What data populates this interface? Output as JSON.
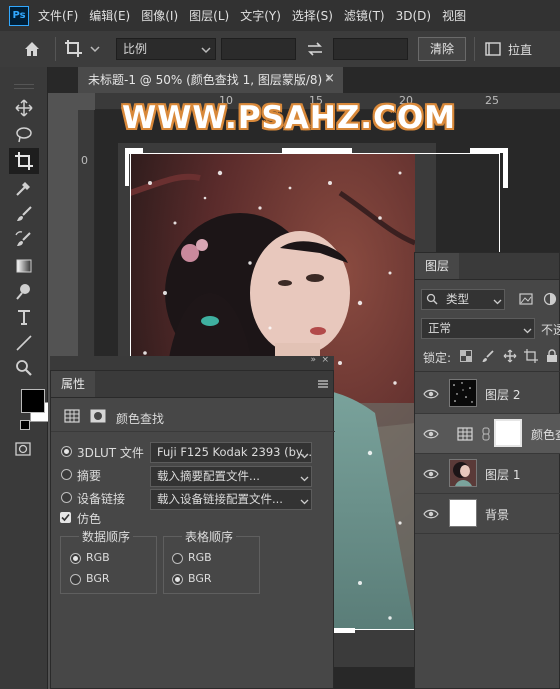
{
  "app": {
    "logo": "Ps"
  },
  "menu": [
    "文件(F)",
    "编辑(E)",
    "图像(I)",
    "图层(L)",
    "文字(Y)",
    "选择(S)",
    "滤镜(T)",
    "3D(D)",
    "视图"
  ],
  "options_bar": {
    "ratio_label": "比例",
    "clear_button": "清除",
    "straighten_label": "拉直"
  },
  "document_tab": {
    "title": "未标题-1 @ 50% (颜色查找 1, 图层蒙版/8) *",
    "close": "×"
  },
  "ruler": {
    "top_ticks": [
      "10",
      "15",
      "20",
      "25"
    ],
    "left_ticks": [
      "0"
    ]
  },
  "watermark": "WWW.PSAHZ.COM",
  "properties_panel": {
    "tab": "属性",
    "subtitle": "颜色查找",
    "options": [
      {
        "label": "3DLUT 文件",
        "selected": true,
        "dropdown": "Fuji F125 Kodak 2393 (by..."
      },
      {
        "label": "摘要",
        "selected": false,
        "dropdown": "载入摘要配置文件..."
      },
      {
        "label": "设备链接",
        "selected": false,
        "dropdown": "载入设备链接配置文件..."
      }
    ],
    "dither": {
      "label": "仿色",
      "checked": true
    },
    "data_order": {
      "title": "数据顺序",
      "options": [
        "RGB",
        "BGR"
      ],
      "selected": "RGB"
    },
    "table_order": {
      "title": "表格顺序",
      "options": [
        "RGB",
        "BGR"
      ],
      "selected": "BGR"
    }
  },
  "layers_panel": {
    "tab": "图层",
    "filter_label": "类型",
    "blend_mode": "正常",
    "opacity_label": "不透",
    "lock_label": "锁定:",
    "layers": [
      {
        "name": "图层 2",
        "type": "snow"
      },
      {
        "name": "颜色查",
        "type": "adjustment"
      },
      {
        "name": "图层 1",
        "type": "photo"
      },
      {
        "name": "背景",
        "type": "white"
      }
    ]
  },
  "colors": {
    "foreground": "#000000",
    "background": "#ffffff"
  }
}
